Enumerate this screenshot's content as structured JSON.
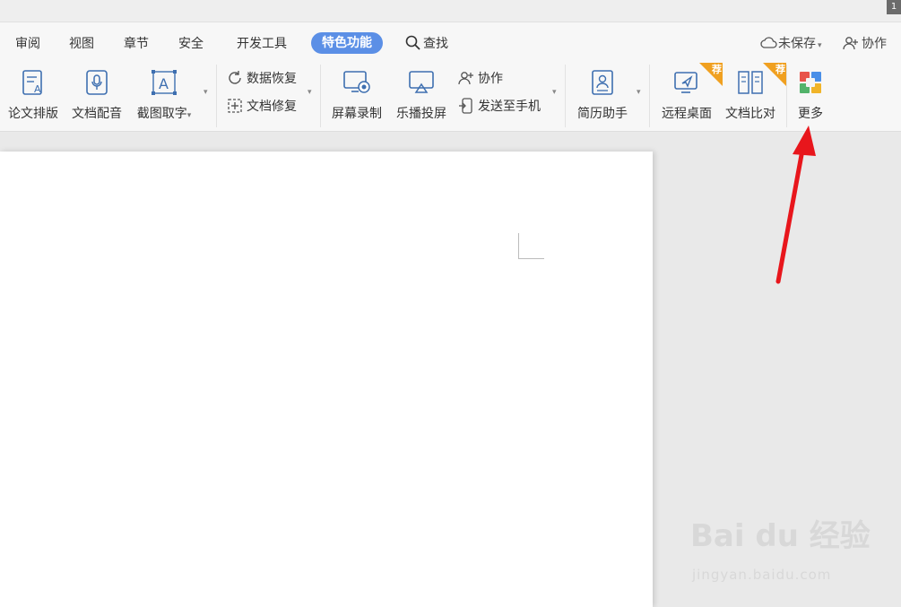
{
  "titlebar": {
    "corner_badge": "1"
  },
  "menubar": {
    "tabs": [
      "审阅",
      "视图",
      "章节",
      "安全",
      "开发工具",
      "特色功能"
    ],
    "active_tab": "特色功能",
    "search_label": "查找",
    "unsaved_label": "未保存",
    "collab_label": "协作"
  },
  "ribbon": {
    "paper_format": "论文排版",
    "doc_dubbing": "文档配音",
    "screenshot_ocr": "截图取字",
    "data_recovery": "数据恢复",
    "doc_repair": "文档修复",
    "screen_record": "屏幕录制",
    "cast_screen": "乐播投屏",
    "collab": "协作",
    "send_phone": "发送至手机",
    "resume_helper": "简历助手",
    "remote_desktop": "远程桌面",
    "doc_compare": "文档比对",
    "more": "更多",
    "recommend_badge": "荐"
  },
  "watermark": {
    "brand": "Bai du 经验",
    "url": "jingyan.baidu.com"
  },
  "colors": {
    "active_tab_bg": "#5b8fe6",
    "arrow": "#e8161c",
    "recommend_badge": "#f0a020"
  }
}
